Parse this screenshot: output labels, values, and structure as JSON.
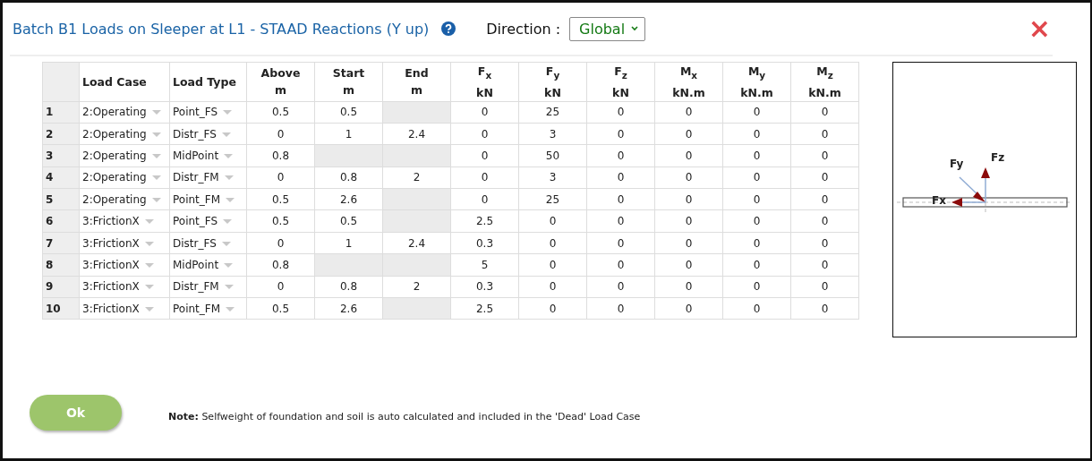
{
  "title": "Batch B1 Loads on Sleeper at L1 - STAAD Reactions (Y up)",
  "direction": {
    "label": "Direction :",
    "value": "Global"
  },
  "close": "×",
  "table": {
    "columns": [
      {
        "kind": "index"
      },
      {
        "name": "Load Case",
        "kind": "dropdown"
      },
      {
        "name": "Load Type",
        "kind": "dropdown"
      },
      {
        "name": "Above",
        "unit": "m",
        "kind": "number"
      },
      {
        "name": "Start",
        "unit": "m",
        "kind": "number"
      },
      {
        "name": "End",
        "unit": "m",
        "kind": "number"
      },
      {
        "name": "F$_{x}$",
        "unit": "kN",
        "kind": "number"
      },
      {
        "name": "F$_{y}$",
        "unit": "kN",
        "kind": "number"
      },
      {
        "name": "F$_{z}$",
        "unit": "kN",
        "kind": "number"
      },
      {
        "name": "M$_{x}$",
        "unit": "kN.m",
        "kind": "number"
      },
      {
        "name": "M$_{y}$",
        "unit": "kN.m",
        "kind": "number"
      },
      {
        "name": "M$_{z}$",
        "unit": "kN.m",
        "kind": "number"
      }
    ],
    "rows": [
      {
        "cells": [
          "1",
          "2:Operating",
          "Point_FS",
          "0.5",
          "0.5",
          null,
          "0",
          "25",
          "0",
          "0",
          "0",
          "0"
        ]
      },
      {
        "cells": [
          "2",
          "2:Operating",
          "Distr_FS",
          "0",
          "1",
          "2.4",
          "0",
          "3",
          "0",
          "0",
          "0",
          "0"
        ]
      },
      {
        "cells": [
          "3",
          "2:Operating",
          "MidPoint",
          "0.8",
          null,
          null,
          "0",
          "50",
          "0",
          "0",
          "0",
          "0"
        ]
      },
      {
        "cells": [
          "4",
          "2:Operating",
          "Distr_FM",
          "0",
          "0.8",
          "2",
          "0",
          "3",
          "0",
          "0",
          "0",
          "0"
        ]
      },
      {
        "cells": [
          "5",
          "2:Operating",
          "Point_FM",
          "0.5",
          "2.6",
          null,
          "0",
          "25",
          "0",
          "0",
          "0",
          "0"
        ]
      },
      {
        "cells": [
          "6",
          "3:FrictionX",
          "Point_FS",
          "0.5",
          "0.5",
          null,
          "2.5",
          "0",
          "0",
          "0",
          "0",
          "0"
        ]
      },
      {
        "cells": [
          "7",
          "3:FrictionX",
          "Distr_FS",
          "0",
          "1",
          "2.4",
          "0.3",
          "0",
          "0",
          "0",
          "0",
          "0"
        ]
      },
      {
        "cells": [
          "8",
          "3:FrictionX",
          "MidPoint",
          "0.8",
          null,
          null,
          "5",
          "0",
          "0",
          "0",
          "0",
          "0"
        ]
      },
      {
        "cells": [
          "9",
          "3:FrictionX",
          "Distr_FM",
          "0",
          "0.8",
          "2",
          "0.3",
          "0",
          "0",
          "0",
          "0",
          "0"
        ]
      },
      {
        "cells": [
          "10",
          "3:FrictionX",
          "Point_FM",
          "0.5",
          "2.6",
          null,
          "2.5",
          "0",
          "0",
          "0",
          "0",
          "0"
        ]
      }
    ]
  },
  "diagram": {
    "labels": {
      "fy": "Fy",
      "fz": "Fz",
      "fx": "Fx"
    }
  },
  "ok_button": "Ok",
  "note": "**Note:** Selfweight of foundation and soil is auto calculated and included in the 'Dead' Load Case"
}
